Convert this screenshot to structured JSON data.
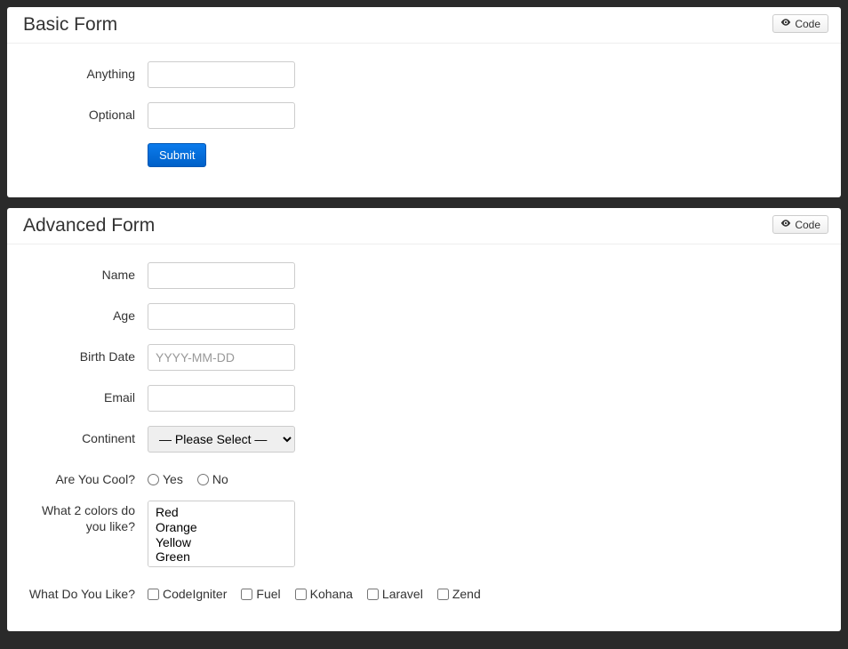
{
  "code_button_label": "Code",
  "basic": {
    "title": "Basic Form",
    "fields": {
      "anything": "Anything",
      "optional": "Optional"
    },
    "submit_label": "Submit"
  },
  "advanced": {
    "title": "Advanced Form",
    "fields": {
      "name": "Name",
      "age": "Age",
      "birthdate": "Birth Date",
      "birthdate_placeholder": "YYYY-MM-DD",
      "email": "Email",
      "continent": "Continent",
      "continent_placeholder": "— Please Select —",
      "cool": "Are You Cool?",
      "cool_yes": "Yes",
      "cool_no": "No",
      "colors": "What 2 colors do you like?",
      "like": "What Do You Like?"
    },
    "color_options": [
      "Red",
      "Orange",
      "Yellow",
      "Green"
    ],
    "like_options": [
      "CodeIgniter",
      "Fuel",
      "Kohana",
      "Laravel",
      "Zend"
    ]
  }
}
